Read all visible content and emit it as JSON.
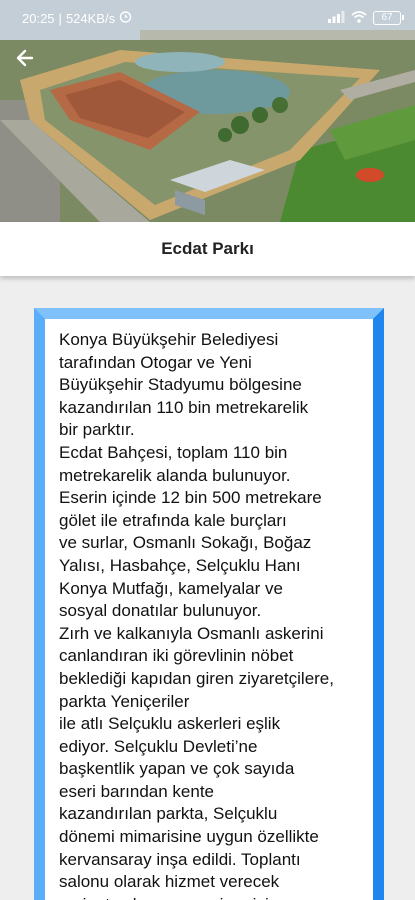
{
  "status_bar": {
    "time": "20:25",
    "speed": "524KB/s",
    "battery": "67"
  },
  "hero": {
    "image_icon": "aerial-park-photo"
  },
  "header": {
    "back_icon": "back-arrow-icon",
    "title": "Ecdat Parkı"
  },
  "content": {
    "text": "Konya Büyükşehir Belediyesi\ntarafından Otogar ve Yeni\nBüyükşehir Stadyumu bölgesine\nkazandırılan 110 bin metrekarelik\nbir parktır.\nEcdat Bahçesi, toplam 110 bin\nmetrekarelik alanda bulunuyor.\nEserin içinde 12 bin 500 metrekare\ngölet ile etrafında kale burçları\nve surlar, Osmanlı Sokağı, Boğaz\nYalısı, Hasbahçe, Selçuklu Hanı\nKonya Mutfağı, kamelyalar ve\nsosyal donatılar bulunuyor.\nZırh ve kalkanıyla Osmanlı askerini\ncanlandıran iki görevlinin nöbet\nbeklediği kapıdan giren ziyaretçilere,\nparkta Yeniçeriler\nile atlı Selçuklu askerleri eşlik\nediyor. Selçuklu Devleti’ne\nbaşkentlik yapan ve çok sayıda\neseri barından kente\nkazandırılan parkta, Selçuklu\ndönemi mimarisine uygun özellikte\nkervansaray inşa edildi. Toplantı\nsalonu olarak hizmet verecek\nyerin, taç kapısı ve mimarisi"
  },
  "colors": {
    "card_border": "#1f86f0",
    "page_background": "#eeeeee"
  }
}
